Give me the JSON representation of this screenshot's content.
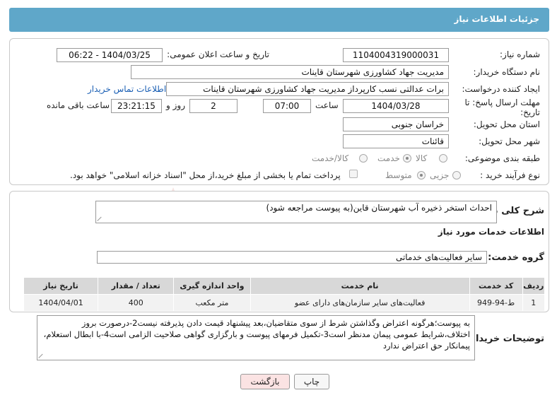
{
  "header": {
    "title": "جزئیات اطلاعات نیاز"
  },
  "fields": {
    "need_number_label": "شماره نیاز:",
    "need_number": "1104004319000031",
    "announce_label": "تاریخ و ساعت اعلان عمومی:",
    "announce_value": "1404/03/25 - 06:22",
    "buyer_org_label": "نام دستگاه خریدار:",
    "buyer_org": "مدیریت جهاد کشاورزی شهرستان قاینات",
    "requester_label": "ایجاد کننده درخواست:",
    "requester": "برات عدالتی نسب کارپرداز مدیریت جهاد کشاورزی شهرستان قاینات",
    "buyer_contact_link": "اطلاعات تماس خریدار",
    "deadline_label_1": "مهلت ارسال پاسخ: تا",
    "deadline_label_2": "تاریخ:",
    "deadline_date": "1404/03/28",
    "time_label": "ساعت",
    "deadline_time": "07:00",
    "days_value": "2",
    "days_label": "روز و",
    "remaining_time": "23:21:15",
    "remaining_label": "ساعت باقی مانده",
    "province_label": "استان محل تحویل:",
    "province": "خراسان جنوبی",
    "city_label": "شهر محل تحویل:",
    "city": "قائنات",
    "category_label": "طبقه بندی موضوعی:",
    "category_options": [
      "کالا",
      "خدمت",
      "کالا/خدمت"
    ],
    "category_selected": "خدمت",
    "process_label": "نوع فرآیند خرید :",
    "process_options": [
      "جزیی",
      "متوسط"
    ],
    "process_selected": "متوسط",
    "payment_note": "پرداخت تمام یا بخشی از مبلغ خرید،از محل \"اسناد خزانه اسلامی\" خواهد بود."
  },
  "description": {
    "label": "شرح کلی نیاز:",
    "text": "احداث استخر ذخیره آب شهرستان قاین(به پیوست مراجعه شود)"
  },
  "services": {
    "section_title": "اطلاعات خدمات مورد نیاز",
    "group_label": "گروه خدمت:",
    "group_value": "سایر فعالیت‌های خدماتی",
    "columns": [
      "ردیف",
      "کد خدمت",
      "نام خدمت",
      "واحد اندازه گیری",
      "تعداد / مقدار",
      "تاریخ نیاز"
    ],
    "rows": [
      [
        "1",
        "ط-94-949",
        "فعالیت‌های سایر سازمان‌های دارای عضو",
        "متر مکعب",
        "400",
        "1404/04/01"
      ]
    ]
  },
  "buyer_notes": {
    "label": "توضیحات خریدار:",
    "text": "به پیوست؛هرگونه اعتراض وگذاشتن شرط از سوی متقاضیان،بعد پیشنهاد قیمت دادن پذیرفته نیست2-درصورت بروز اختلاف،شرایط عمومی پیمان مدنظر است3-تکمیل فرمهای پیوست و بارگزاری گواهی صلاحیت الزامی است4-با ابطال استعلام، پیمانکار حق اعتراض ندارد"
  },
  "buttons": {
    "print": "چاپ",
    "back": "بازگشت"
  },
  "watermark": {
    "text": "AriaTender.neT"
  },
  "colors": {
    "header": "#5fa7c9",
    "back_button": "#fbe3e3",
    "link": "#1a5fb4"
  }
}
